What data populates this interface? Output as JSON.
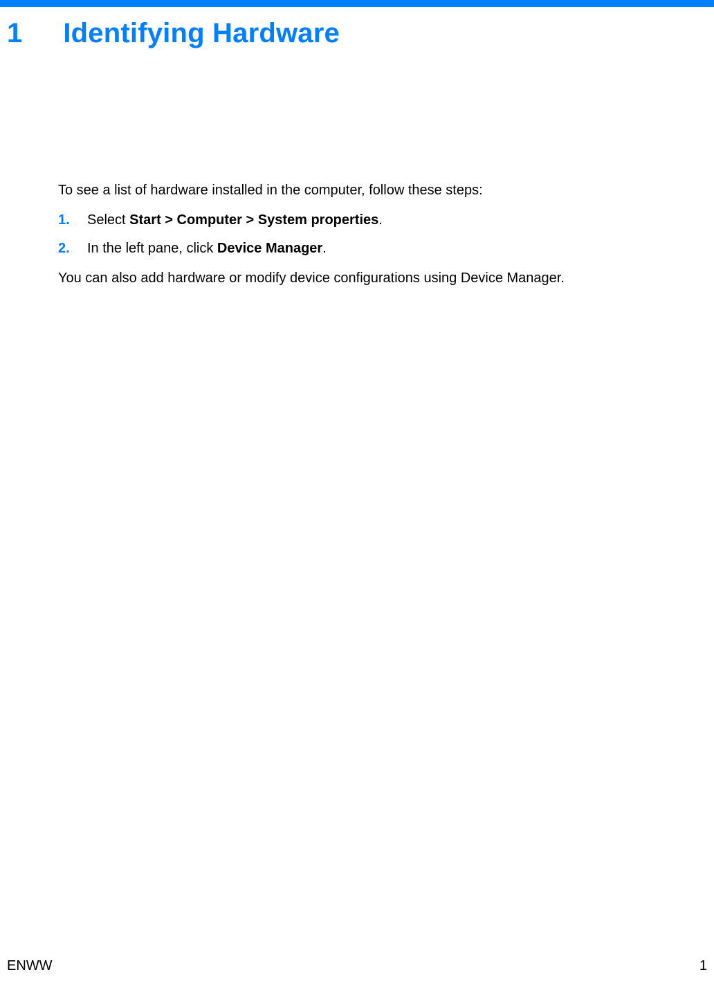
{
  "accent_color": "#007fff",
  "heading": {
    "number": "1",
    "title": "Identifying Hardware"
  },
  "intro": "To see a list of hardware installed in the computer, follow these steps:",
  "steps": [
    {
      "marker": "1.",
      "pre": "Select ",
      "bold": "Start > Computer > System properties",
      "post": "."
    },
    {
      "marker": "2.",
      "pre": "In the left pane, click ",
      "bold": "Device Manager",
      "post": "."
    }
  ],
  "outro": "You can also add hardware or modify device configurations using Device Manager.",
  "footer": {
    "left": "ENWW",
    "right": "1"
  }
}
